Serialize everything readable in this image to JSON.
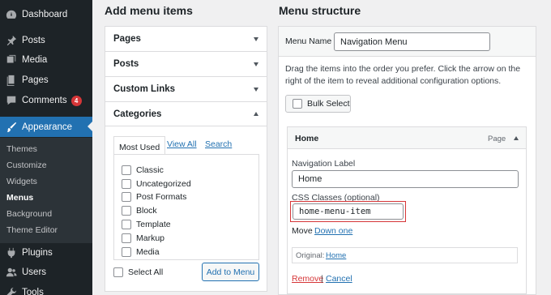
{
  "sidebar": {
    "items": [
      {
        "label": "Dashboard",
        "icon": "dashboard-icon"
      },
      {
        "label": "Posts",
        "icon": "pin-icon"
      },
      {
        "label": "Media",
        "icon": "media-icon"
      },
      {
        "label": "Pages",
        "icon": "pages-icon"
      },
      {
        "label": "Comments",
        "icon": "comment-icon",
        "badge": "4"
      },
      {
        "label": "Appearance",
        "icon": "paintbrush-icon",
        "active": true
      },
      {
        "label": "Plugins",
        "icon": "plugin-icon"
      },
      {
        "label": "Users",
        "icon": "users-icon"
      },
      {
        "label": "Tools",
        "icon": "tools-icon"
      }
    ],
    "submenu": [
      "Themes",
      "Customize",
      "Widgets",
      "Menus",
      "Background",
      "Theme Editor"
    ],
    "submenu_current": "Menus"
  },
  "add_items": {
    "heading": "Add menu items",
    "sections": [
      "Pages",
      "Posts",
      "Custom Links"
    ],
    "categories": {
      "title": "Categories",
      "tabs": [
        "Most Used",
        "View All",
        "Search"
      ],
      "items": [
        "Classic",
        "Uncategorized",
        "Post Formats",
        "Block",
        "Template",
        "Markup",
        "Media"
      ],
      "select_all": "Select All",
      "add_button": "Add to Menu"
    }
  },
  "structure": {
    "heading": "Menu structure",
    "menu_name_label": "Menu Name",
    "menu_name_value": "Navigation Menu",
    "help_text": "Drag the items into the order you prefer. Click the arrow on the right of the item to reveal additional configuration options.",
    "bulk_select": "Bulk Select",
    "item": {
      "title": "Home",
      "type": "Page",
      "nav_label_caption": "Navigation Label",
      "nav_label_value": "Home",
      "css_caption": "CSS Classes (optional)",
      "css_value": "home-menu-item",
      "move_label": "Move",
      "move_link": "Down one",
      "original_label": "Original:",
      "original_link": "Home",
      "remove": "Remove",
      "separator": "|",
      "cancel": "Cancel"
    }
  },
  "colors": {
    "sidebar_bg": "#1d2327",
    "accent": "#2271b1",
    "badge": "#d63638",
    "highlight_border": "#d63638"
  }
}
